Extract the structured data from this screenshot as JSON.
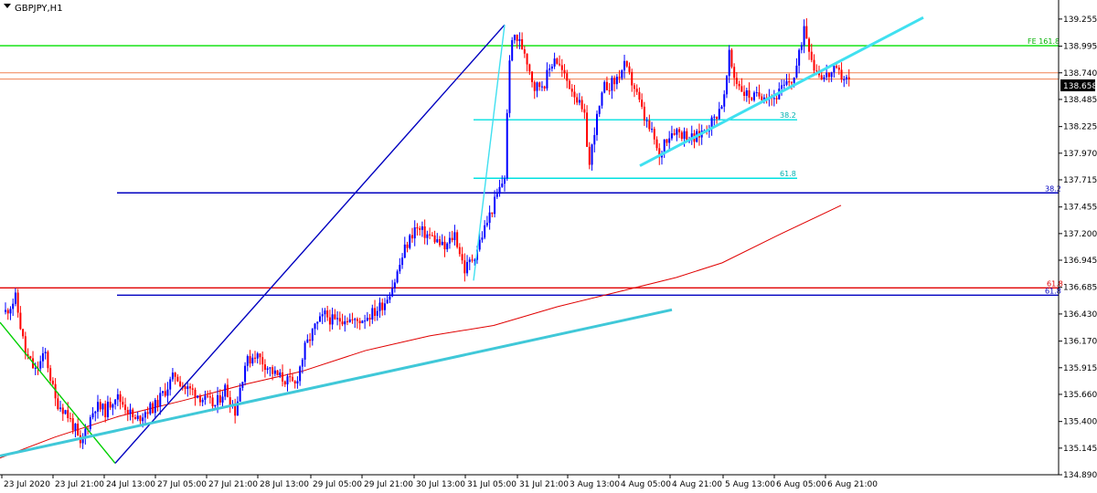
{
  "window": {
    "symbol_title": "GBPJPY,H1",
    "price_badge": "138.658"
  },
  "chart_data": {
    "type": "candlestick",
    "title": "GBPJPY,H1",
    "ylim": [
      134.89,
      139.35
    ],
    "y_ticks": [
      "139.255",
      "138.995",
      "138.740",
      "138.485",
      "138.225",
      "137.970",
      "137.715",
      "137.455",
      "137.200",
      "136.945",
      "136.685",
      "136.430",
      "136.170",
      "135.915",
      "135.660",
      "135.400",
      "135.145",
      "134.890"
    ],
    "x_ticks": [
      "23 Jul 2020",
      "23 Jul 21:00",
      "24 Jul 13:00",
      "27 Jul 05:00",
      "27 Jul 21:00",
      "28 Jul 13:00",
      "29 Jul 05:00",
      "29 Jul 21:00",
      "30 Jul 13:00",
      "31 Jul 05:00",
      "31 Jul 21:00",
      "3 Aug 13:00",
      "4 Aug 05:00",
      "4 Aug 21:00",
      "5 Aug 13:00",
      "6 Aug 05:00",
      "6 Aug 21:00"
    ],
    "last_price": 138.658,
    "colors": {
      "bull": "#0000ff",
      "bear": "#ff0000"
    },
    "path_points": [
      [
        0,
        136.45
      ],
      [
        4,
        136.58
      ],
      [
        8,
        136.05
      ],
      [
        12,
        135.88
      ],
      [
        16,
        136.05
      ],
      [
        20,
        135.6
      ],
      [
        24,
        135.5
      ],
      [
        28,
        135.32
      ],
      [
        30,
        135.15
      ],
      [
        32,
        135.32
      ],
      [
        36,
        135.55
      ],
      [
        40,
        135.5
      ],
      [
        44,
        135.65
      ],
      [
        48,
        135.55
      ],
      [
        52,
        135.4
      ],
      [
        56,
        135.5
      ],
      [
        60,
        135.55
      ],
      [
        64,
        135.7
      ],
      [
        68,
        135.85
      ],
      [
        72,
        135.72
      ],
      [
        76,
        135.68
      ],
      [
        80,
        135.6
      ],
      [
        84,
        135.55
      ],
      [
        88,
        135.72
      ],
      [
        92,
        135.5
      ],
      [
        96,
        135.95
      ],
      [
        100,
        136.05
      ],
      [
        104,
        135.95
      ],
      [
        108,
        135.85
      ],
      [
        112,
        135.8
      ],
      [
        116,
        135.75
      ],
      [
        120,
        136.1
      ],
      [
        124,
        136.3
      ],
      [
        128,
        136.42
      ],
      [
        132,
        136.35
      ],
      [
        136,
        136.4
      ],
      [
        140,
        136.35
      ],
      [
        144,
        136.4
      ],
      [
        148,
        136.45
      ],
      [
        152,
        136.55
      ],
      [
        156,
        136.75
      ],
      [
        160,
        137.05
      ],
      [
        164,
        137.25
      ],
      [
        168,
        137.2
      ],
      [
        172,
        137.15
      ],
      [
        176,
        137.05
      ],
      [
        180,
        137.2
      ],
      [
        184,
        136.85
      ],
      [
        188,
        137.0
      ],
      [
        192,
        137.25
      ],
      [
        196,
        137.5
      ],
      [
        200,
        137.75
      ],
      [
        202,
        138.9
      ],
      [
        204,
        139.1
      ],
      [
        208,
        138.95
      ],
      [
        212,
        138.6
      ],
      [
        216,
        138.65
      ],
      [
        220,
        138.9
      ],
      [
        224,
        138.7
      ],
      [
        228,
        138.55
      ],
      [
        232,
        138.3
      ],
      [
        234,
        137.85
      ],
      [
        236,
        138.2
      ],
      [
        240,
        138.6
      ],
      [
        244,
        138.65
      ],
      [
        248,
        138.8
      ],
      [
        252,
        138.6
      ],
      [
        256,
        138.3
      ],
      [
        260,
        138.1
      ],
      [
        262,
        137.9
      ],
      [
        264,
        138.1
      ],
      [
        268,
        138.2
      ],
      [
        272,
        138.15
      ],
      [
        276,
        138.1
      ],
      [
        280,
        138.2
      ],
      [
        284,
        138.3
      ],
      [
        288,
        138.5
      ],
      [
        290,
        138.9
      ],
      [
        292,
        138.7
      ],
      [
        296,
        138.55
      ],
      [
        300,
        138.5
      ],
      [
        304,
        138.55
      ],
      [
        308,
        138.5
      ],
      [
        312,
        138.6
      ],
      [
        316,
        138.7
      ],
      [
        318,
        138.9
      ],
      [
        320,
        139.2
      ],
      [
        322,
        139.0
      ],
      [
        324,
        138.8
      ],
      [
        328,
        138.7
      ],
      [
        332,
        138.75
      ],
      [
        336,
        138.7
      ],
      [
        338,
        138.66
      ]
    ],
    "levels": [
      {
        "name": "FE 161.8",
        "price": 139.0,
        "color": "#00e000",
        "text_color": "#00b000"
      },
      {
        "name": "38.2",
        "price": 138.29,
        "color": "#00e0e0",
        "text_color": "#00b0b0"
      },
      {
        "name": "61.8",
        "price": 137.73,
        "color": "#00e0e0",
        "text_color": "#00b0b0"
      },
      {
        "name": "38.2",
        "price": 137.59,
        "color": "#0000c0",
        "text_color": "#0000c0"
      },
      {
        "name": "61.8",
        "price": 136.68,
        "color": "#e00000",
        "text_color": "#e00000"
      },
      {
        "name": "61.8",
        "price": 136.61,
        "color": "#0000c0",
        "text_color": "#0000c0"
      }
    ],
    "level_price_a": 138.74,
    "level_price_b": 138.68
  }
}
